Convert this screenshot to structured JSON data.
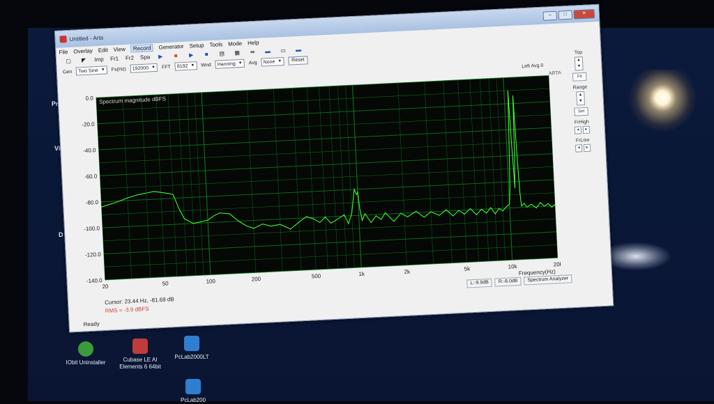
{
  "window": {
    "title": "Untitled - Arta",
    "controls": [
      "–",
      "□",
      "✕"
    ]
  },
  "menu": [
    "File",
    "Overlay",
    "Edit",
    "View",
    "Record",
    "Generator",
    "Setup",
    "Tools",
    "Mode",
    "Help"
  ],
  "toolbar": {
    "buttons": [
      "Imp",
      "Fr1",
      "Fr2",
      "Spa"
    ]
  },
  "params": {
    "gen_label": "Gen",
    "gen_value": "Two Sine",
    "fs_label": "Fs(Hz)",
    "fs_value": "192000",
    "fft_label": "FFT",
    "fft_value": "8192",
    "wnd_label": "Wnd",
    "wnd_value": "Hanning",
    "avg_label": "Avg",
    "avg_value": "None",
    "reset_label": "Reset"
  },
  "right_panel": {
    "top_label": "Top",
    "fit_label": "Fit",
    "range_label": "Range",
    "set_label": "Set",
    "frhigh_label": "FrHigh",
    "frlow_label": "FrLow"
  },
  "plot_header": {
    "left_avg": "Left Avg.0",
    "arta": "ARTA"
  },
  "cursor": "Cursor: 23.44 Hz, -81.69 dB",
  "rms": "RMS = -3.9 dBFS",
  "status_panes": [
    "L:-9.9dB",
    "R:-8.0dB",
    "Spectrum Analyzer"
  ],
  "statusbar": "Ready",
  "desktop_icons": [
    {
      "label1": "IObit Uninstaller",
      "label2": "",
      "color": "#3c9a3c"
    },
    {
      "label1": "Cubase LE AI",
      "label2": "Elements 6 64bit",
      "color": "#c03b3b"
    },
    {
      "label1": "PcLab2000LT",
      "label2": "",
      "color": "#2f7fd0"
    },
    {
      "label1": "PcLab200",
      "label2": "",
      "color": "#2f7fd0"
    }
  ],
  "colors": {
    "plot_bg": "#050805",
    "grid": "#0f7a1f",
    "trace": "#37ff2e"
  },
  "chart_data": {
    "type": "line",
    "title": "Spectrum magnitude dBFS",
    "xlabel": "Frequency(Hz)",
    "ylabel": "",
    "x_scale": "log",
    "xlim": [
      20,
      20000
    ],
    "ylim": [
      -140,
      0
    ],
    "x_ticks": [
      20,
      50,
      100,
      200,
      500,
      1000,
      2000,
      5000,
      10000,
      20000
    ],
    "x_tick_labels": [
      "20",
      "50",
      "100",
      "200",
      "500",
      "1k",
      "2k",
      "5k",
      "10k",
      "20k"
    ],
    "y_ticks": [
      0,
      -20,
      -40,
      -60,
      -80,
      -100,
      -120,
      -140
    ],
    "y_tick_labels": [
      "0.0",
      "-20.0",
      "-40.0",
      "-60.0",
      "-80.0",
      "-100.0",
      "-120.0",
      "-140.0"
    ],
    "grid": true,
    "series": [
      {
        "name": "",
        "x": [
          20,
          25,
          30,
          35,
          40,
          45,
          50,
          55,
          60,
          65,
          70,
          80,
          90,
          100,
          110,
          120,
          140,
          160,
          180,
          200,
          230,
          260,
          300,
          350,
          400,
          450,
          500,
          550,
          600,
          650,
          700,
          750,
          800,
          850,
          900,
          950,
          980,
          1000,
          1020,
          1050,
          1100,
          1200,
          1300,
          1400,
          1500,
          1700,
          1900,
          2100,
          2400,
          2700,
          3000,
          3400,
          3800,
          4200,
          4600,
          5000,
          5500,
          6000,
          6500,
          7000,
          7500,
          8000,
          8500,
          9000,
          9500,
          10000,
          10200,
          10400,
          10600,
          10800,
          11000,
          11200,
          11400,
          11600,
          11800,
          12000,
          12500,
          13000,
          14000,
          15000,
          16000,
          17000,
          18000,
          19000,
          20000
        ],
        "y": [
          -84,
          -81,
          -78,
          -76,
          -75,
          -74,
          -75,
          -76,
          -77,
          -88,
          -96,
          -100,
          -99,
          -98,
          -95,
          -93,
          -94,
          -100,
          -104,
          -106,
          -103,
          -105,
          -104,
          -108,
          -103,
          -99,
          -101,
          -104,
          -100,
          -105,
          -103,
          -101,
          -99,
          -106,
          -98,
          -80,
          -84,
          -82,
          -95,
          -104,
          -99,
          -106,
          -101,
          -104,
          -99,
          -106,
          -100,
          -103,
          -99,
          -104,
          -100,
          -103,
          -99,
          -104,
          -100,
          -103,
          -99,
          -104,
          -100,
          -103,
          -99,
          -104,
          -100,
          -102,
          -99,
          -97,
          -84,
          -48,
          -10,
          -52,
          -85,
          -60,
          -14,
          -56,
          -88,
          -99,
          -97,
          -100,
          -98,
          -101,
          -97,
          -100,
          -98,
          -101,
          -99
        ]
      }
    ]
  }
}
